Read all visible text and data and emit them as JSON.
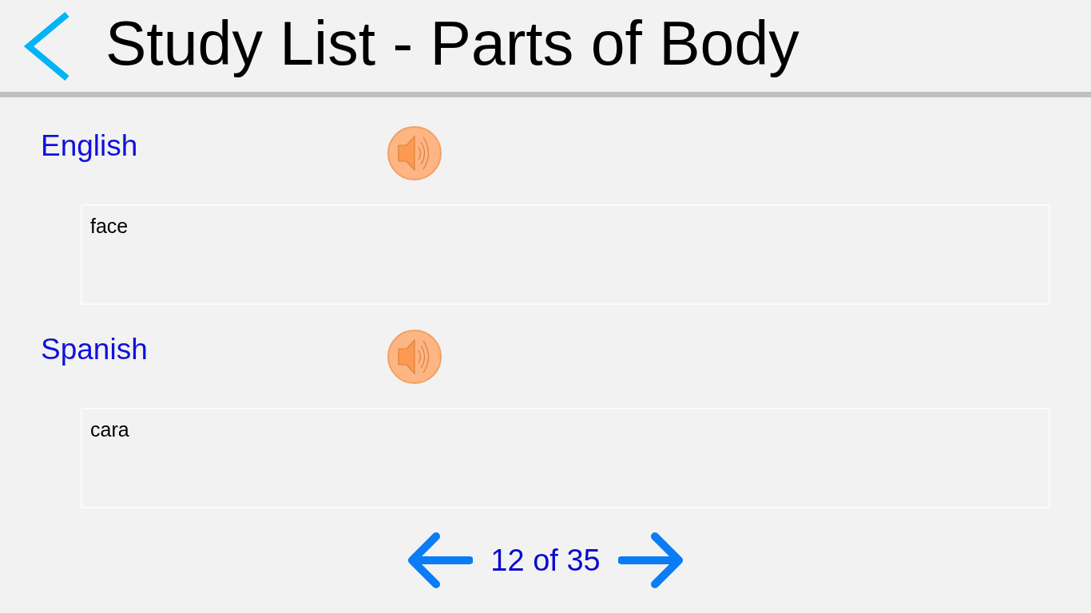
{
  "header": {
    "title": "Study List - Parts of Body"
  },
  "entries": [
    {
      "language": "English",
      "text": "face"
    },
    {
      "language": "Spanish",
      "text": "cara"
    }
  ],
  "pager": {
    "position": "12 of 35"
  }
}
